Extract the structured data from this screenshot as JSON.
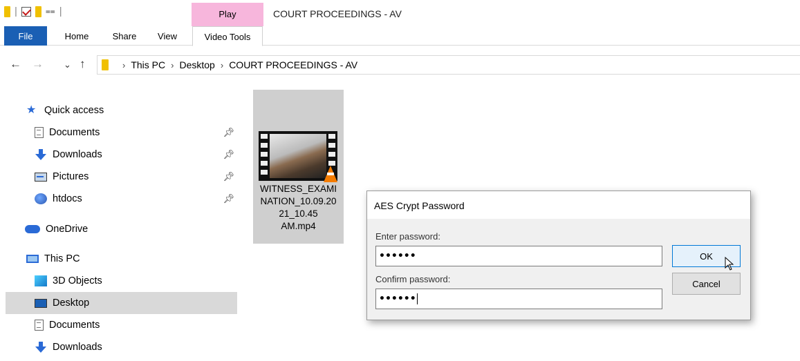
{
  "window": {
    "title": "COURT PROCEEDINGS - AV",
    "context_tab": "Play"
  },
  "ribbon": {
    "tabs": [
      "File",
      "Home",
      "Share",
      "View",
      "Video Tools"
    ]
  },
  "address": {
    "crumbs": [
      "This PC",
      "Desktop",
      "COURT PROCEEDINGS - AV"
    ],
    "separator": "›"
  },
  "sidebar": {
    "quick_access": "Quick access",
    "pinned": [
      {
        "label": "Documents",
        "icon": "document-icon"
      },
      {
        "label": "Downloads",
        "icon": "download-icon"
      },
      {
        "label": "Pictures",
        "icon": "pictures-icon"
      },
      {
        "label": "htdocs",
        "icon": "network-folder-icon"
      }
    ],
    "onedrive": "OneDrive",
    "this_pc": "This PC",
    "pc_items": [
      {
        "label": "3D Objects",
        "icon": "3d-objects-icon"
      },
      {
        "label": "Desktop",
        "icon": "desktop-icon",
        "selected": true
      },
      {
        "label": "Documents",
        "icon": "document-icon"
      },
      {
        "label": "Downloads",
        "icon": "download-icon"
      }
    ]
  },
  "file": {
    "name": "WITNESS_EXAMINATION_10.09.2021_10.45 AM.mp4",
    "name_lines": [
      "WITNESS_EXAMI",
      "NATION_10.09.20",
      "21_10.45",
      "AM.mp4"
    ],
    "icon": "vlc-video-thumbnail"
  },
  "dialog": {
    "title": "AES Crypt Password",
    "enter_label": "Enter password:",
    "enter_value": "••••••",
    "confirm_label": "Confirm password:",
    "confirm_value": "••••••",
    "ok": "OK",
    "cancel": "Cancel"
  },
  "colors": {
    "file_tab": "#1a5fb4",
    "play_tab": "#f7b6dc",
    "selection": "#d9d9d9",
    "accent": "#0078d7"
  }
}
